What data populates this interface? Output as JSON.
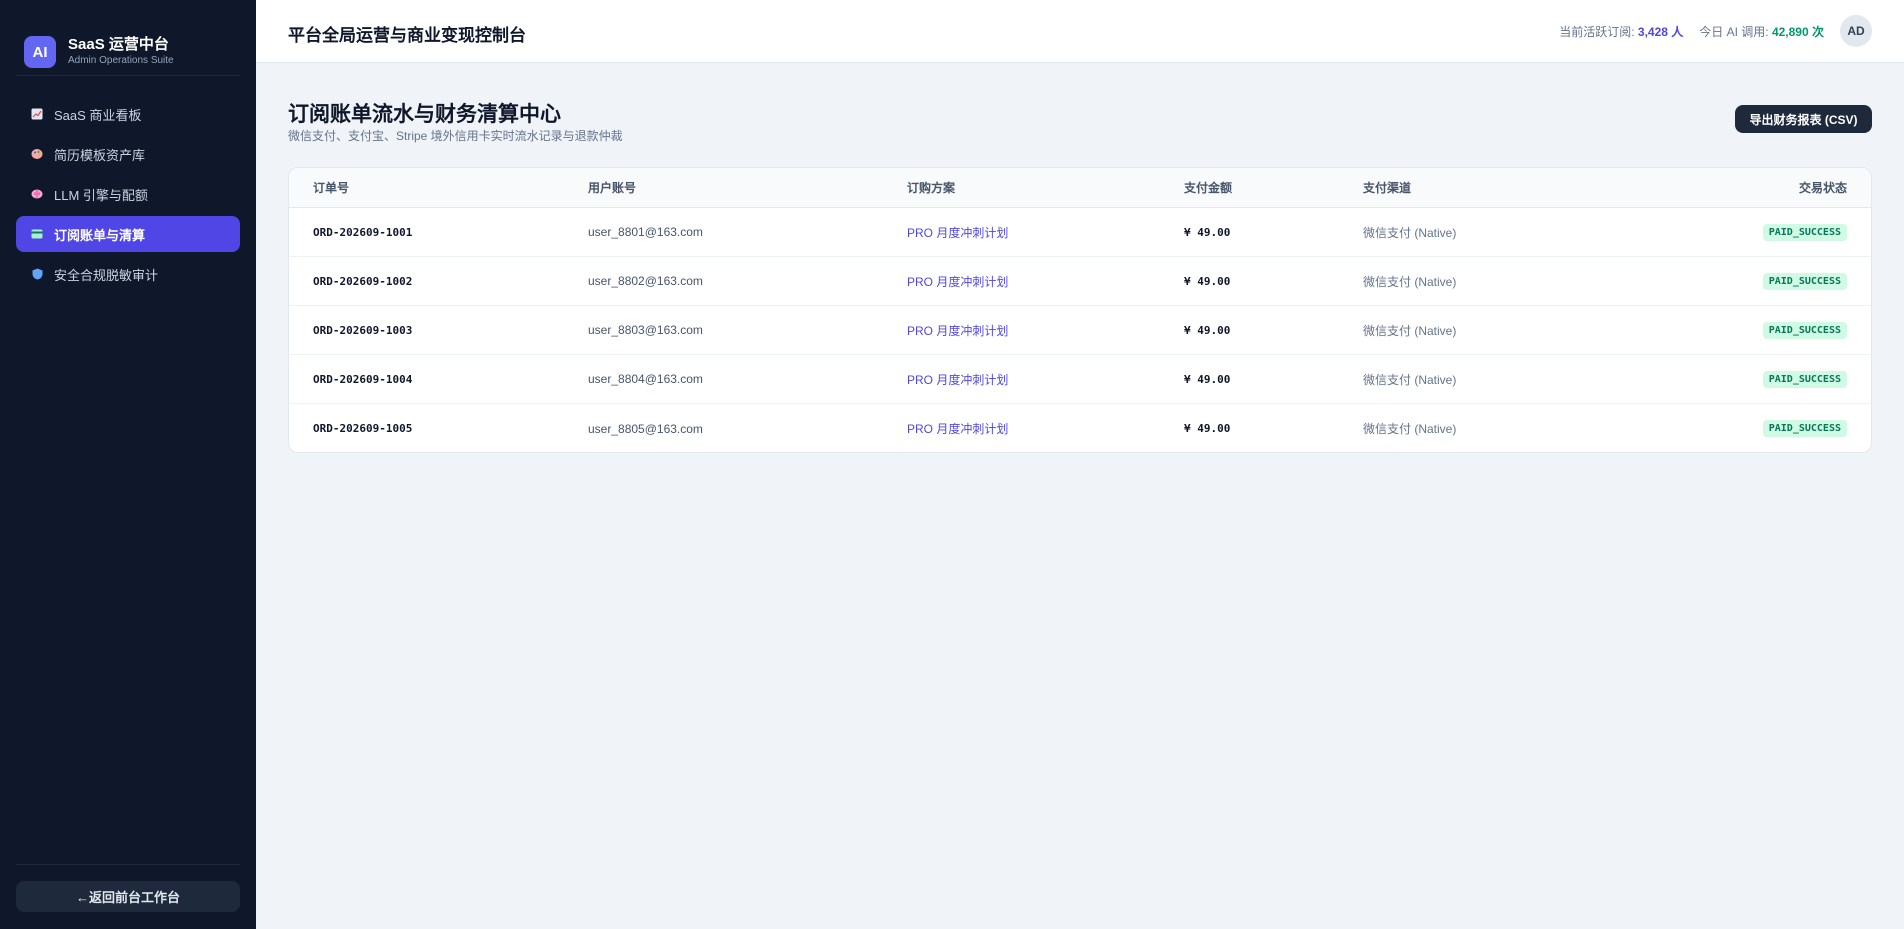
{
  "sidebar": {
    "logo": "AI",
    "title": "SaaS 运营中台",
    "subtitle": "Admin Operations Suite",
    "items": [
      {
        "icon": "chart-icon",
        "label": "SaaS 商业看板",
        "active": false
      },
      {
        "icon": "palette-icon",
        "label": "简历模板资产库",
        "active": false
      },
      {
        "icon": "brain-icon",
        "label": "LLM 引擎与配额",
        "active": false
      },
      {
        "icon": "credit-card-icon",
        "label": "订阅账单与清算",
        "active": true
      },
      {
        "icon": "shield-icon",
        "label": "安全合规脱敏审计",
        "active": false
      }
    ],
    "back_label": "←返回前台工作台"
  },
  "header": {
    "title": "平台全局运营与商业变现控制台",
    "subs_label": "当前活跃订阅: ",
    "subs_value": "3,428 人",
    "ai_label": "今日 AI 调用: ",
    "ai_value": "42,890 次",
    "avatar": "AD"
  },
  "main": {
    "title": "订阅账单流水与财务清算中心",
    "subtitle": "微信支付、支付宝、Stripe 境外信用卡实时流水记录与退款仲裁",
    "export_label": "导出财务报表 (CSV)",
    "columns": [
      "订单号",
      "用户账号",
      "订购方案",
      "支付金额",
      "支付渠道",
      "交易状态"
    ],
    "rows": [
      {
        "order": "ORD-202609-1001",
        "user": "user_8801@163.com",
        "plan": "PRO 月度冲刺计划",
        "amount": "¥ 49.00",
        "channel": "微信支付 (Native)",
        "status": "PAID_SUCCESS"
      },
      {
        "order": "ORD-202609-1002",
        "user": "user_8802@163.com",
        "plan": "PRO 月度冲刺计划",
        "amount": "¥ 49.00",
        "channel": "微信支付 (Native)",
        "status": "PAID_SUCCESS"
      },
      {
        "order": "ORD-202609-1003",
        "user": "user_8803@163.com",
        "plan": "PRO 月度冲刺计划",
        "amount": "¥ 49.00",
        "channel": "微信支付 (Native)",
        "status": "PAID_SUCCESS"
      },
      {
        "order": "ORD-202609-1004",
        "user": "user_8804@163.com",
        "plan": "PRO 月度冲刺计划",
        "amount": "¥ 49.00",
        "channel": "微信支付 (Native)",
        "status": "PAID_SUCCESS"
      },
      {
        "order": "ORD-202609-1005",
        "user": "user_8805@163.com",
        "plan": "PRO 月度冲刺计划",
        "amount": "¥ 49.00",
        "channel": "微信支付 (Native)",
        "status": "PAID_SUCCESS"
      }
    ]
  },
  "colors": {
    "sidebar_bg": "#0f172a",
    "accent": "#4f46e5",
    "success": "#059669"
  }
}
